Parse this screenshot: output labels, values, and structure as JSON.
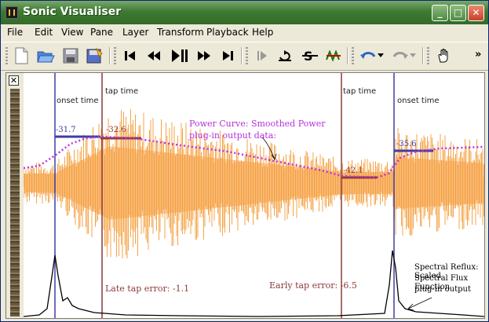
{
  "window": {
    "title": "Sonic Visualiser"
  },
  "menu": [
    "File",
    "Edit",
    "View",
    "Pane",
    "Layer",
    "Transform",
    "Playback",
    "Help"
  ],
  "toolbar": {
    "overflow": "»"
  },
  "labels": {
    "onset_left": "onset time",
    "tap_left": "tap time",
    "tap_right": "tap time",
    "onset_right": "onset time"
  },
  "values": {
    "v1": "-31.7",
    "v2": "-32.6",
    "v3": "-42.1",
    "v4": "-35.6"
  },
  "annotations": {
    "power_curve_1": "Power Curve: Smoothed Power",
    "power_curve_2": "plug-in output data:",
    "late_tap": "Late tap error: -1.1",
    "early_tap": "Early tap error: -6.5",
    "flux_1": "Spectral Reflux: Scaled",
    "flux_2": "Spectral Flux Function",
    "flux_3": "plug-in output"
  },
  "colors": {
    "waveform": "#f39a35",
    "waveform_fill": "#fbcfa4",
    "power": "#bf33e0",
    "onset_line": "#3e3ea6",
    "tap_line": "#8c3a3a"
  }
}
